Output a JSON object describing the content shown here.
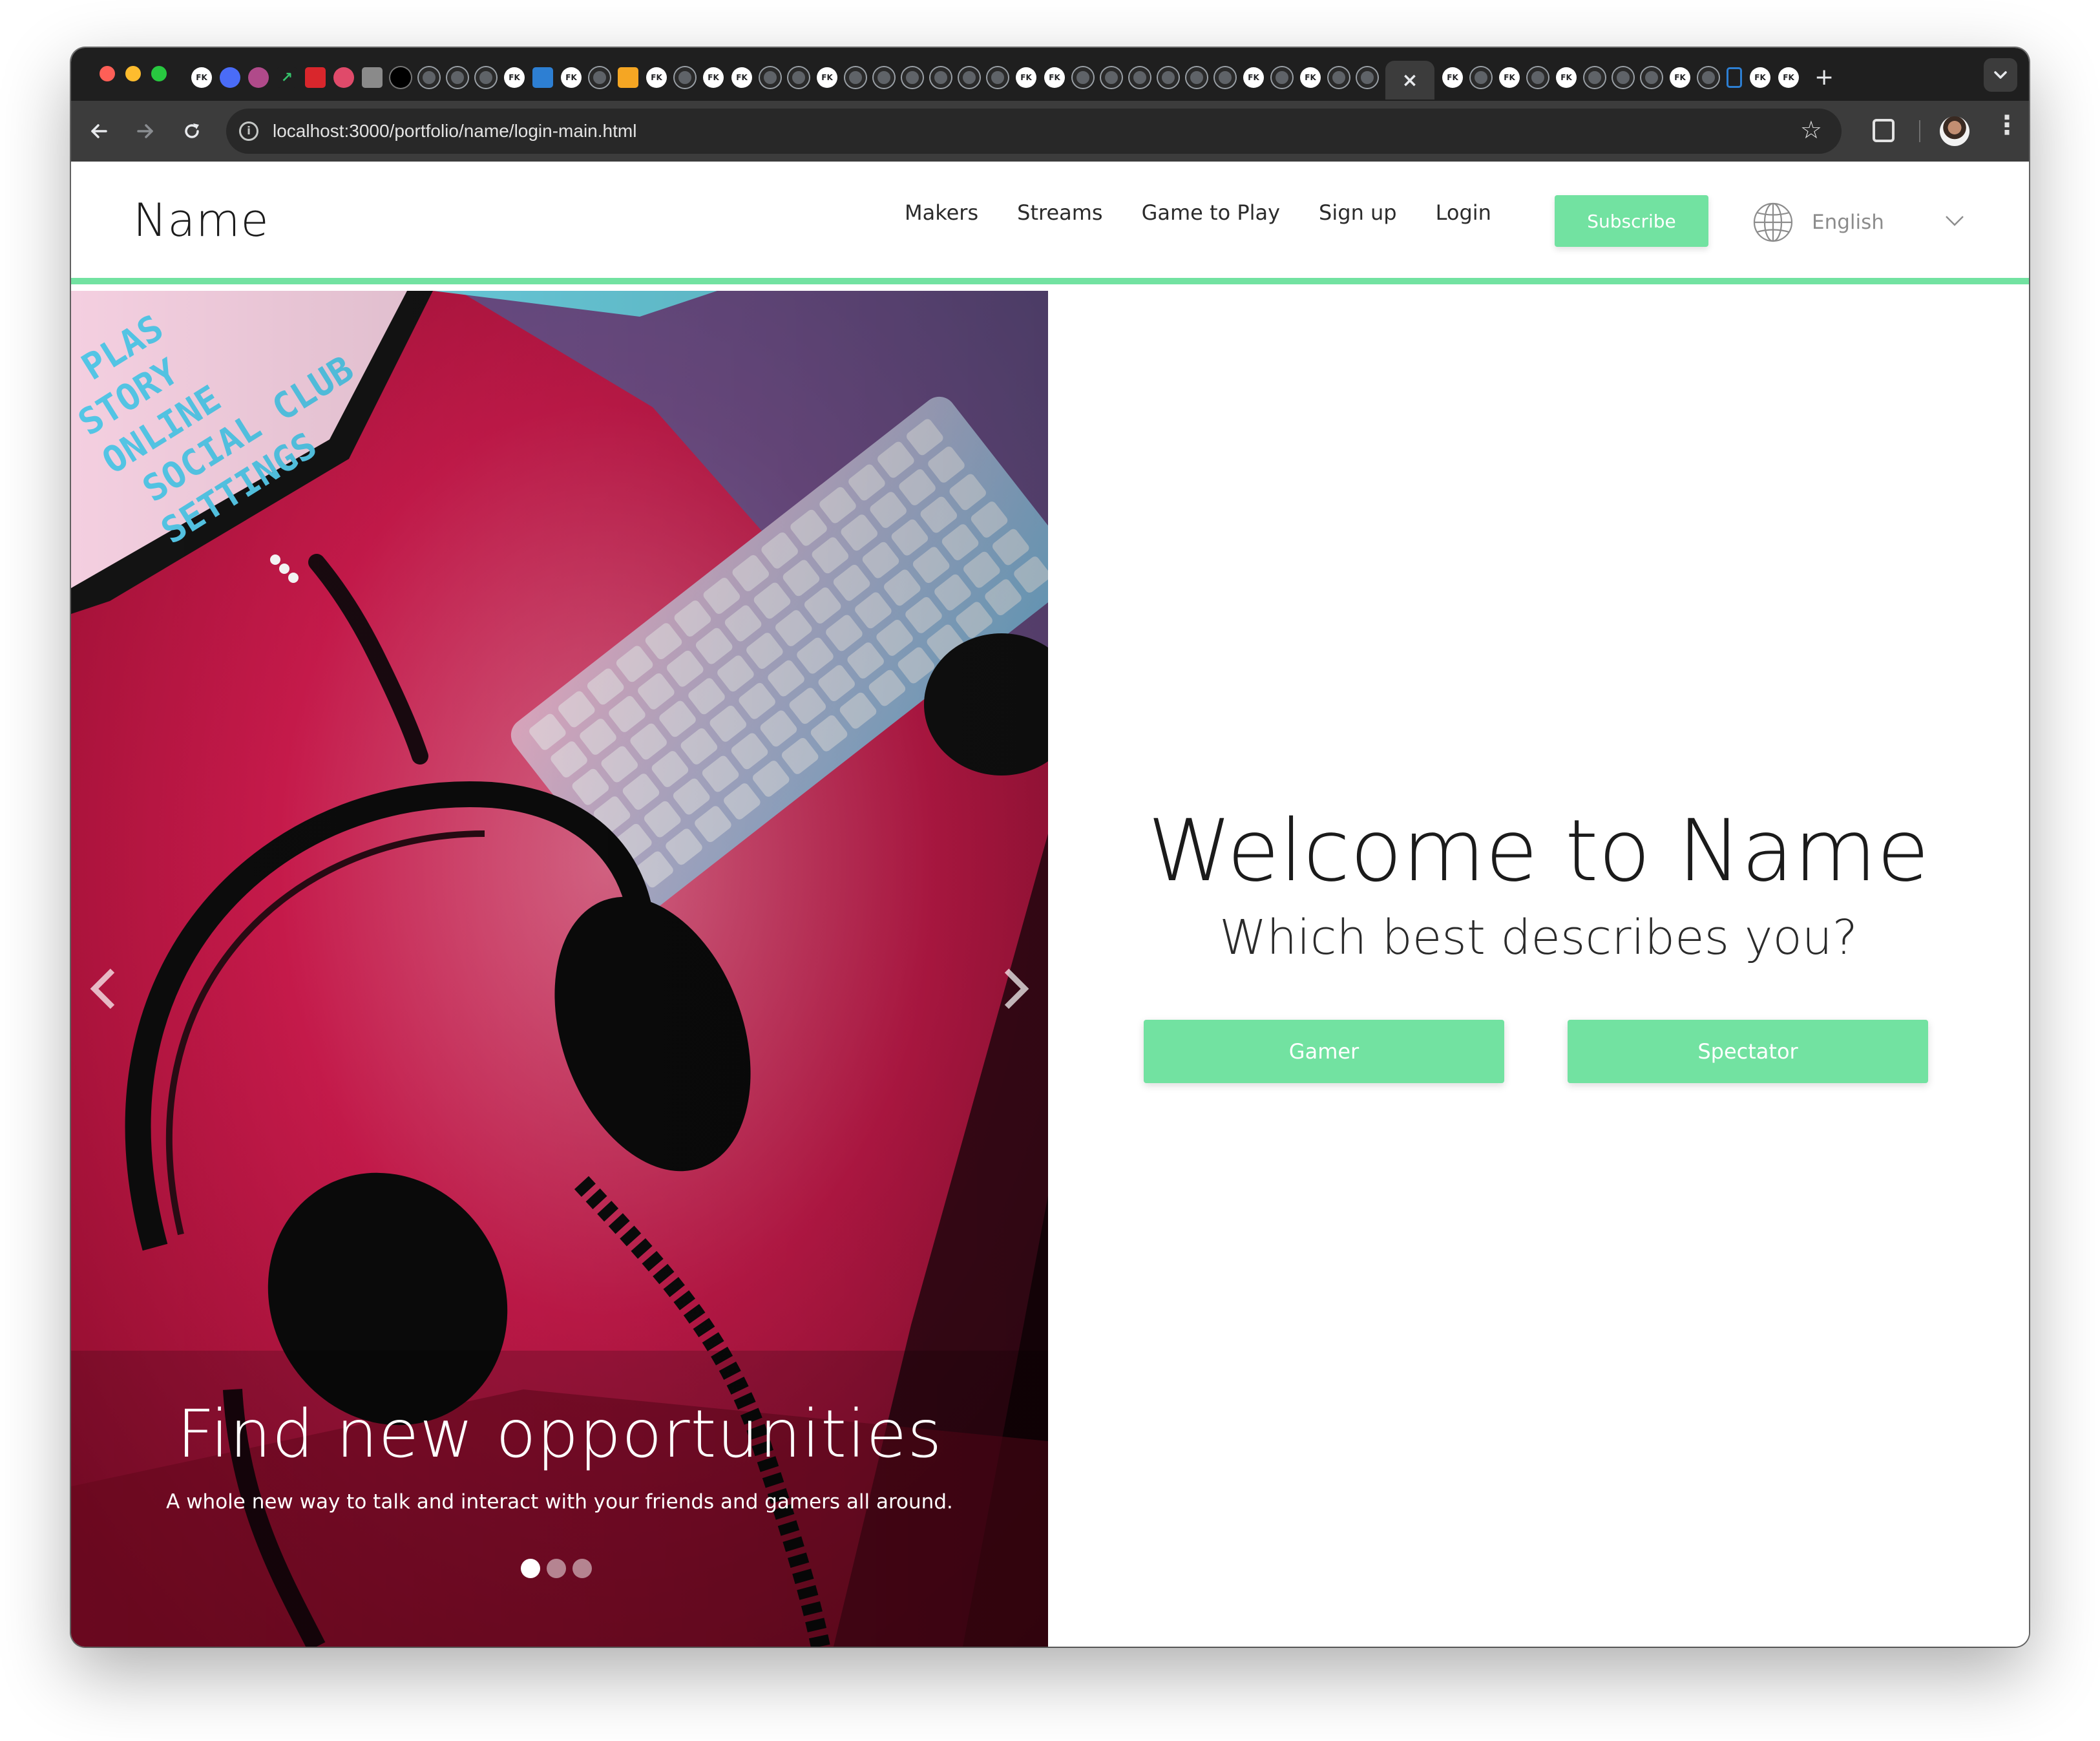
{
  "browser": {
    "url": "localhost:3000/portfolio/name/login-main.html",
    "new_tab_symbol": "+",
    "close_symbol": "×",
    "tab_menu_symbol": "⌄",
    "colors": {
      "frame": "#1f1f1f",
      "toolbar": "#3c3c3c",
      "omnibox": "#282828",
      "text": "#e3e3e3"
    }
  },
  "site": {
    "brand": "Name",
    "nav": [
      {
        "label": "Makers"
      },
      {
        "label": "Streams"
      },
      {
        "label": "Game to Play"
      },
      {
        "label": "Sign up"
      },
      {
        "label": "Login"
      }
    ],
    "subscribe_label": "Subscribe",
    "language": "English",
    "accent_color": "#72e2a1"
  },
  "carousel": {
    "screen_words": [
      "PLAS",
      "STORY",
      "ONLINE",
      "SOCIAL CLUB",
      "SETTINGS"
    ],
    "title": "Find new opportunities",
    "text": "A whole new way to talk and interact with your friends and gamers all around.",
    "slide_count": 3,
    "active_slide": 1
  },
  "welcome": {
    "title": "Welcome to Name",
    "subtitle": "Which best describes you?",
    "buttons": {
      "gamer": "Gamer",
      "spectator": "Spectator"
    }
  }
}
